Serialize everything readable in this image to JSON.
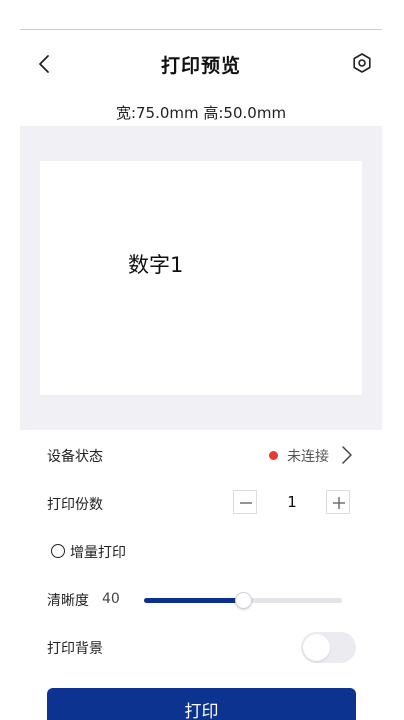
{
  "header": {
    "title": "打印预览",
    "back_icon": "chevron-left-icon",
    "settings_icon": "hexagon-settings-icon"
  },
  "dimensions": "宽:75.0mm 高:50.0mm",
  "preview": {
    "label_text": "数字1"
  },
  "device_status": {
    "label": "设备状态",
    "value": "未连接",
    "status_color": "#e53935"
  },
  "copies": {
    "label": "打印份数",
    "value": "1"
  },
  "incremental": {
    "label": "增量打印",
    "checked": false
  },
  "clarity": {
    "label": "清晰度",
    "value": "40",
    "level_fraction": 0.5
  },
  "print_background": {
    "label": "打印背景",
    "enabled": false
  },
  "print_button": {
    "label": "打印"
  },
  "colors": {
    "primary": "#0d3391",
    "preview_bg": "#f1f1f5"
  }
}
